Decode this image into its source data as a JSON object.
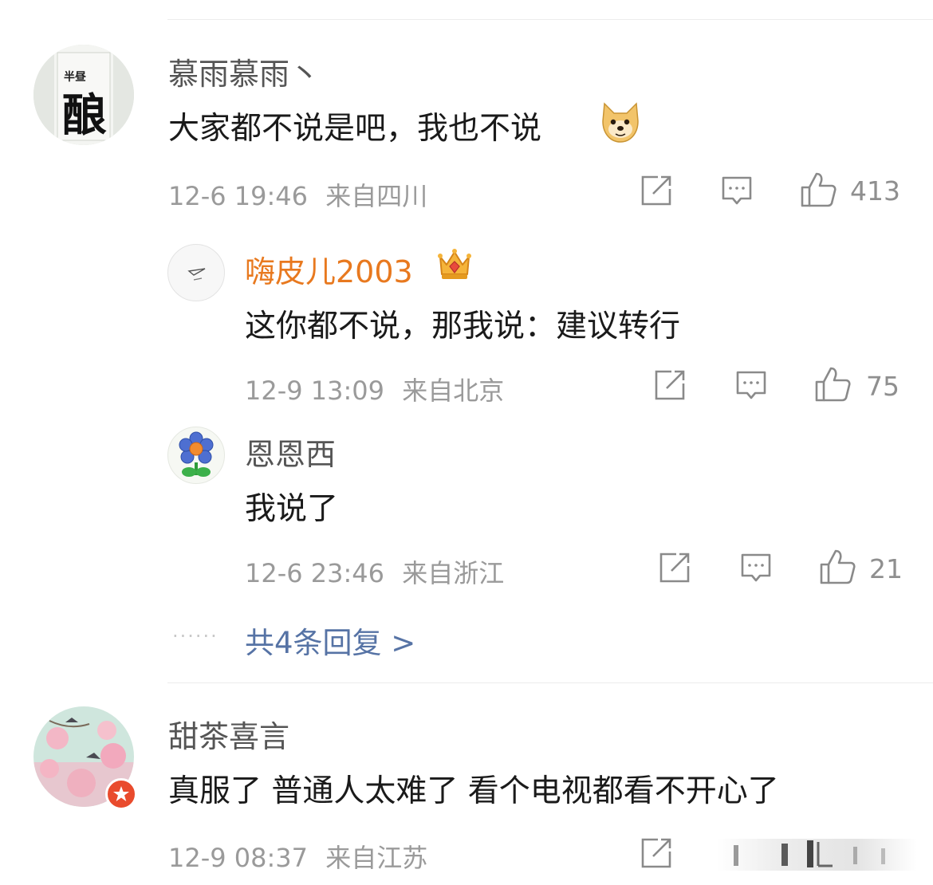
{
  "comments": [
    {
      "user": "慕雨慕雨丶",
      "text": "大家都不说是吧，我也不说",
      "time": "12-6 19:46",
      "location": "来自四川",
      "likes": "413",
      "avatar_text": "半昼 酿"
    },
    {
      "user": "甜茶喜言",
      "text": "真服了  普通人太难了  看个电视都看不开心了",
      "time": "12-9 08:37",
      "location": "来自江苏"
    }
  ],
  "replies": [
    {
      "user": "嗨皮儿2003",
      "text": "这你都不说，那我说：建议转行",
      "time": "12-9 13:09",
      "location": "来自北京",
      "likes": "75"
    },
    {
      "user": "恩恩西",
      "text": "我说了",
      "time": "12-6 23:46",
      "location": "来自浙江",
      "likes": "21"
    }
  ],
  "more_replies": {
    "dots": "······",
    "label": "共4条回复 >"
  },
  "colors": {
    "vip_name": "#e8791f",
    "link": "#5673a5",
    "meta": "#9a9a9a"
  },
  "icons": [
    "share-icon",
    "comment-icon",
    "like-icon",
    "doge-emoji",
    "crown-icon",
    "verified-badge-icon"
  ]
}
